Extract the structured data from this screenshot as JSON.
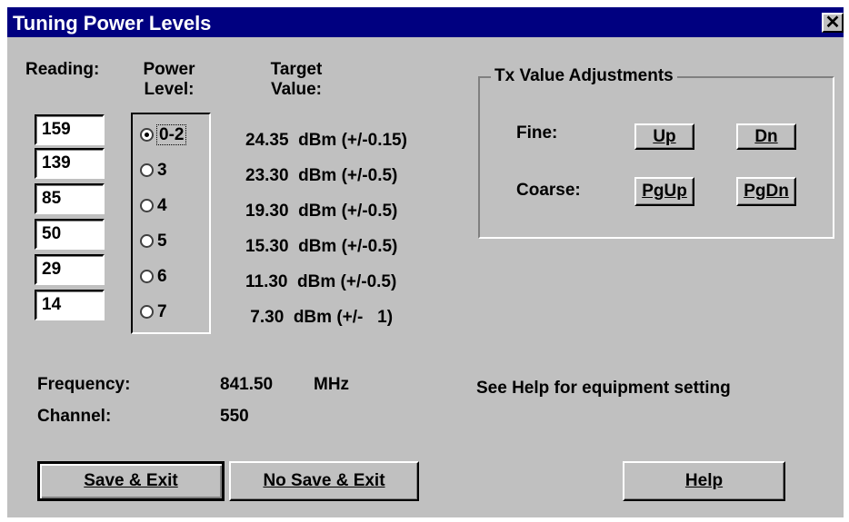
{
  "window": {
    "title": "Tuning Power Levels",
    "close_glyph": "✕"
  },
  "headers": {
    "reading": "Reading:",
    "power_line1": "Power",
    "power_line2": "Level:",
    "target_line1": "Target",
    "target_line2": "Value:"
  },
  "readings": [
    "159",
    "139",
    "85",
    "50",
    "29",
    "14"
  ],
  "power_levels": {
    "selected": "0-2",
    "options": [
      "0-2",
      "3",
      "4",
      "5",
      "6",
      "7"
    ]
  },
  "targets": [
    "24.35  dBm (+/-0.15)",
    "23.30  dBm (+/-0.5)",
    "19.30  dBm (+/-0.5)",
    "15.30  dBm (+/-0.5)",
    "11.30  dBm (+/-0.5)",
    " 7.30  dBm (+/-   1)"
  ],
  "tx_adjustments": {
    "title": "Tx Value Adjustments",
    "fine_label": "Fine:",
    "coarse_label": "Coarse:",
    "up": "Up",
    "dn": "Dn",
    "pgup": "PgUp",
    "pgdn": "PgDn"
  },
  "frequency": {
    "label": "Frequency:",
    "value": "841.50",
    "unit": "MHz"
  },
  "channel": {
    "label": "Channel:",
    "value": "550"
  },
  "help_note": "See Help for equipment setting",
  "buttons": {
    "save_exit": "Save & Exit",
    "no_save_exit": "No Save & Exit",
    "help": "Help"
  }
}
